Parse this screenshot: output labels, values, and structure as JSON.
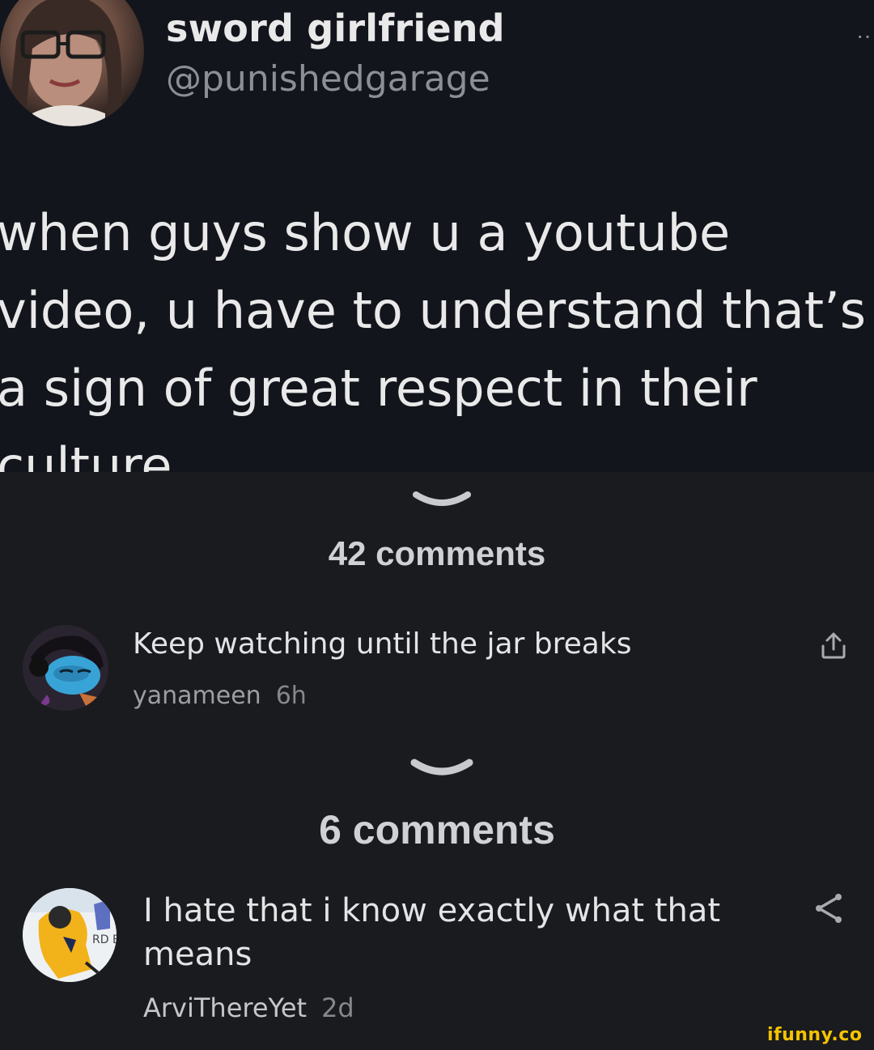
{
  "tweet": {
    "display_name": "sword girlfriend",
    "handle": "@punishedgarage",
    "text_lines": [
      "when guys show u a youtube",
      "video, u have to understand that’s",
      "a sign of great respect in their",
      "culture"
    ]
  },
  "thread1": {
    "comment_count": "42 comments",
    "comment": {
      "text": "Keep watching until the jar breaks",
      "username": "yanameen",
      "time": "6h",
      "action_icon": "share-up-icon"
    }
  },
  "thread2": {
    "comment_count": "6 comments",
    "comment": {
      "text_lines": [
        "I hate that i know exactly what that",
        "means"
      ],
      "username": "ArviThereYet",
      "time": "2d",
      "action_icon": "share-nodes-icon"
    }
  },
  "watermark": "ifunny.co",
  "colors": {
    "tweet_bg": "#13151c",
    "comments_bg": "#1a1b1e",
    "watermark": "#f5c400"
  }
}
